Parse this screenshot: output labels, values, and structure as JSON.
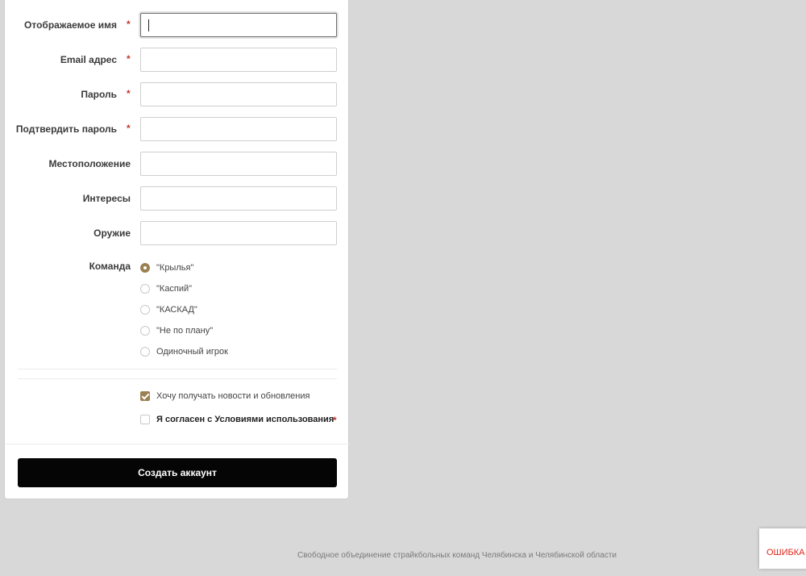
{
  "form": {
    "fields": [
      {
        "label": "Отображаемое имя",
        "required": true,
        "value": ""
      },
      {
        "label": "Email адрес",
        "required": true,
        "value": ""
      },
      {
        "label": "Пароль",
        "required": true,
        "value": ""
      },
      {
        "label": "Подтвердить пароль",
        "required": true,
        "value": ""
      },
      {
        "label": "Местоположение",
        "required": false,
        "value": ""
      },
      {
        "label": "Интересы",
        "required": false,
        "value": ""
      },
      {
        "label": "Оружие",
        "required": false,
        "value": ""
      }
    ],
    "required_mark": "*",
    "team": {
      "label": "Команда",
      "options": [
        {
          "label": "\"Крылья\"",
          "checked": true
        },
        {
          "label": "\"Каспий\"",
          "checked": false
        },
        {
          "label": "\"КАСКАД\"",
          "checked": false
        },
        {
          "label": "\"Не по плану\"",
          "checked": false
        },
        {
          "label": "Одиночный игрок",
          "checked": false
        }
      ]
    },
    "newsletter": {
      "label": "Хочу получать новости и обновления",
      "checked": true
    },
    "terms": {
      "label": "Я согласен с Условиями использования",
      "checked": false
    },
    "submit_label": "Создать аккаунт"
  },
  "footer": {
    "text": "Свободное объединение страйкбольных команд Челябинска и Челябинской области"
  },
  "error_badge": {
    "text": "ОШИБКА"
  },
  "colors": {
    "accent": "#9a8052",
    "required": "#c0392b",
    "button_bg": "#050505",
    "error": "#e0261b"
  }
}
